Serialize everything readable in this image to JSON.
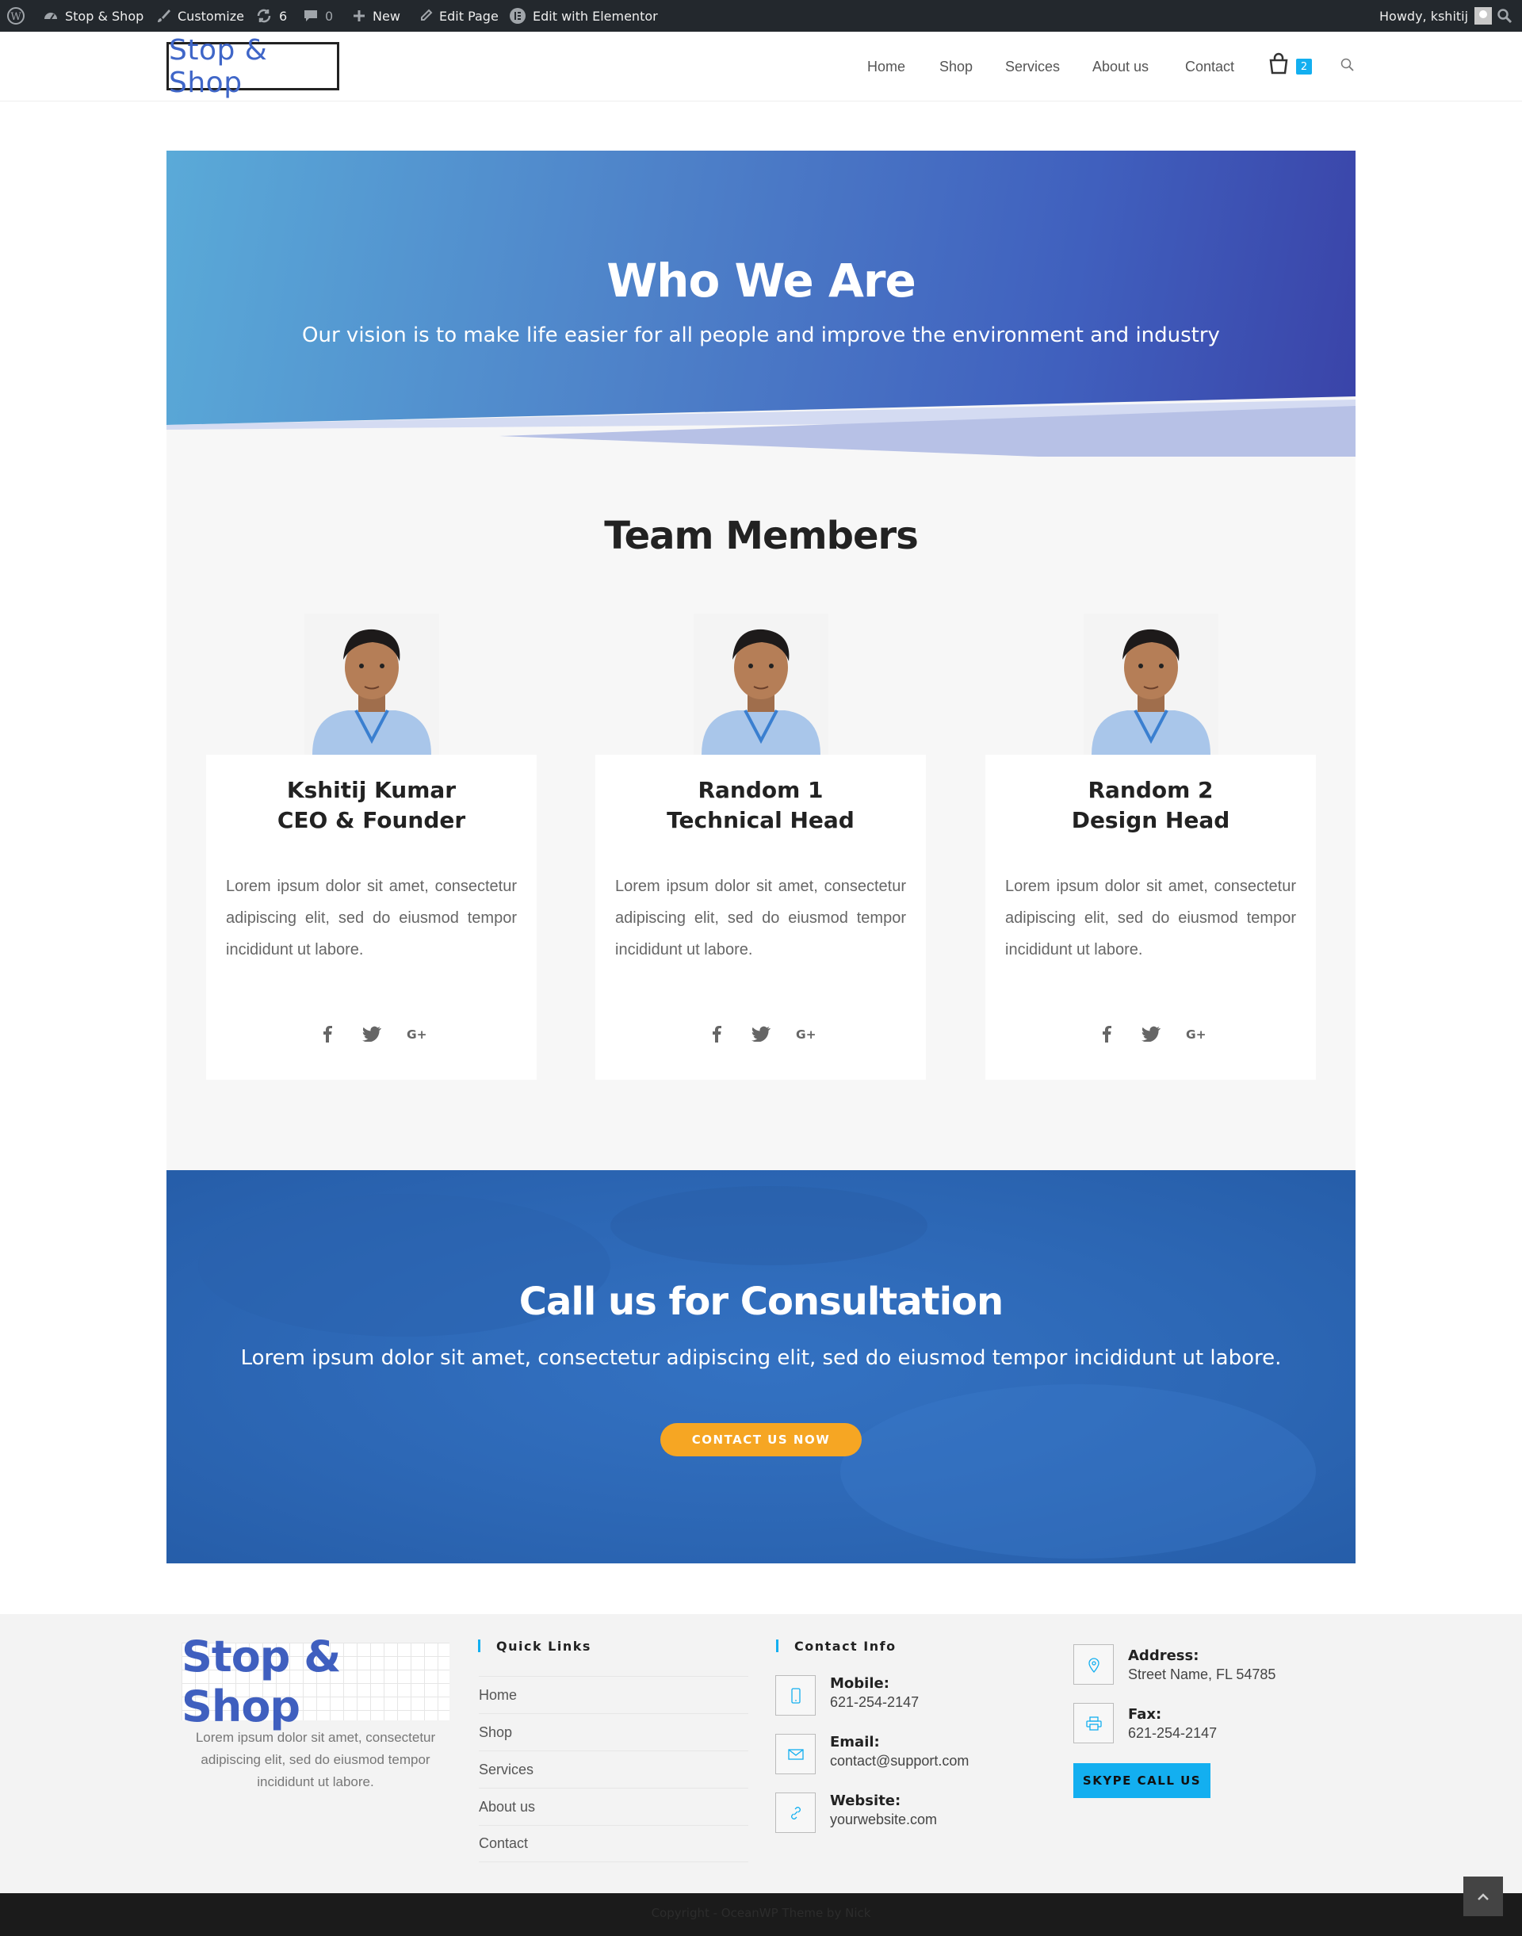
{
  "admin_bar": {
    "site_name": "Stop & Shop",
    "customize": "Customize",
    "updates_count": "6",
    "comments_count": "0",
    "new_label": "New",
    "edit_page": "Edit Page",
    "edit_elementor": "Edit with Elementor",
    "howdy": "Howdy, kshitij"
  },
  "header": {
    "logo_text": "Stop & Shop",
    "nav": [
      "Home",
      "Shop",
      "Services",
      "About us",
      "Contact"
    ],
    "cart_count": "2"
  },
  "hero": {
    "title": "Who We Are",
    "subtitle": "Our vision is to make life easier for all people and improve the environment and industry"
  },
  "team": {
    "title": "Team Members",
    "members": [
      {
        "name": "Kshitij Kumar",
        "role": "CEO & Founder",
        "bio": "Lorem ipsum dolor sit amet, consectetur adipiscing elit, sed do eiusmod tempor incididunt ut labore."
      },
      {
        "name": "Random 1",
        "role": "Technical Head",
        "bio": "Lorem ipsum dolor sit amet, consectetur adipiscing elit, sed do eiusmod tempor incididunt ut labore."
      },
      {
        "name": "Random 2",
        "role": "Design Head",
        "bio": "Lorem ipsum dolor sit amet, consectetur adipiscing elit, sed do eiusmod tempor incididunt ut labore."
      }
    ],
    "social_icons": [
      "facebook-icon",
      "twitter-icon",
      "google-plus-icon"
    ]
  },
  "cta": {
    "title": "Call us for Consultation",
    "text": "Lorem ipsum dolor sit amet, consectetur adipiscing elit, sed do eiusmod tempor incididunt ut labore.",
    "button": "CONTACT US NOW"
  },
  "footer": {
    "logo_text": "Stop & Shop",
    "about": "Lorem ipsum dolor sit amet, consectetur adipiscing elit, sed do eiusmod tempor incididunt ut labore.",
    "quick_links_title": "Quick Links",
    "quick_links": [
      "Home",
      "Shop",
      "Services",
      "About us",
      "Contact"
    ],
    "contact_title": "Contact Info",
    "mobile_label": "Mobile:",
    "mobile": "621-254-2147",
    "email_label": "Email:",
    "email": "contact@support.com",
    "website_label": "Website:",
    "website": "yourwebsite.com",
    "address_label": "Address:",
    "address": "Street Name, FL 54785",
    "fax_label": "Fax:",
    "fax": "621-254-2147",
    "skype_button": "SKYPE CALL US",
    "copyright": "Copyright - OceanWP Theme by Nick"
  },
  "colors": {
    "accent": "#13aff0",
    "cta_button": "#f6a623",
    "cta_bg": "#2f6cbc",
    "hero_start": "#5aaad8",
    "hero_end": "#3a43a8"
  }
}
